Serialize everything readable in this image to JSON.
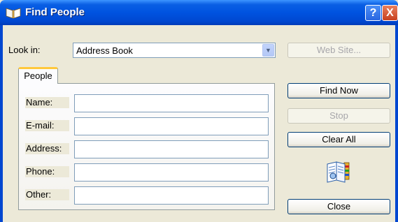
{
  "window": {
    "title": "Find People",
    "help_label": "?",
    "close_label": "X"
  },
  "look_in": {
    "label": "Look in:",
    "value": "Address Book"
  },
  "buttons": {
    "web_site": "Web Site...",
    "find_now": "Find Now",
    "stop": "Stop",
    "clear_all": "Clear All",
    "close": "Close"
  },
  "tabs": [
    {
      "label": "People",
      "active": true
    }
  ],
  "fields": [
    {
      "label": "Name:",
      "value": ""
    },
    {
      "label": "E-mail:",
      "value": ""
    },
    {
      "label": "Address:",
      "value": ""
    },
    {
      "label": "Phone:",
      "value": ""
    },
    {
      "label": "Other:",
      "value": ""
    }
  ],
  "icons": {
    "title": "address-book-icon",
    "combo_arrow": "chevron-down-icon",
    "decorative": "open-book-icon"
  },
  "colors": {
    "titlebar": "#0053e0",
    "dialog_bg": "#ece9d8",
    "tab_highlight": "#ffc83c",
    "close_button": "#c7401f"
  }
}
